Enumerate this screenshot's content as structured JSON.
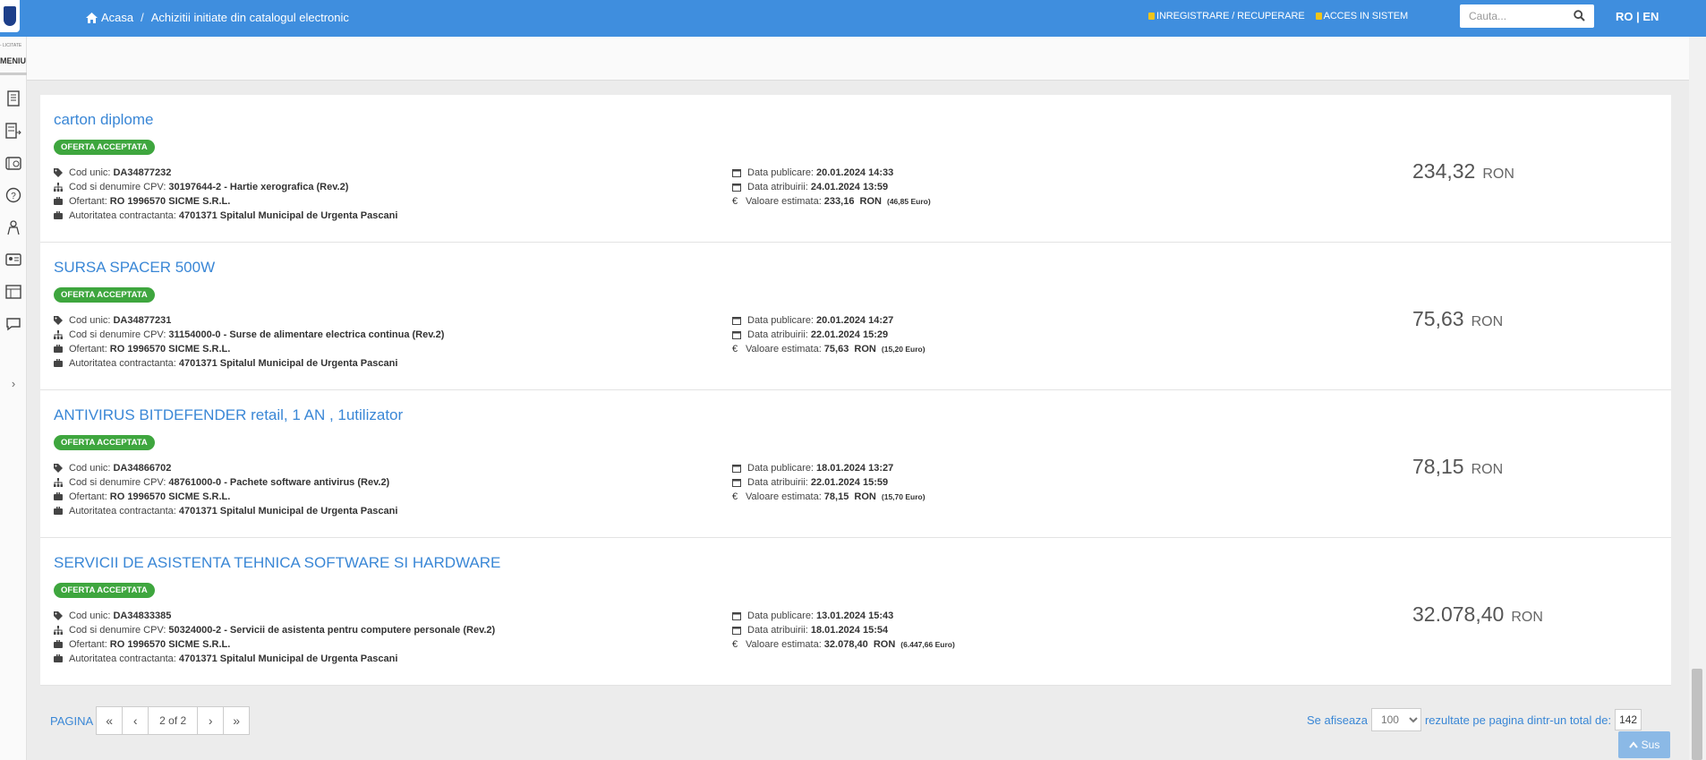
{
  "header": {
    "breadcrumb_home": "Acasa",
    "breadcrumb_separator": "/",
    "breadcrumb_current": "Achizitii initiate din catalogul electronic",
    "register_link": "INREGISTRARE / RECUPERARE",
    "login_link": "ACCES IN SISTEM",
    "search_placeholder": "Cauta...",
    "language": "RO | EN"
  },
  "sidebar": {
    "top_text": "- LICITATE",
    "menu_label": "MENIU",
    "expand_glyph": "›",
    "icons": [
      "document-icon",
      "list-arrow-icon",
      "catalog-icon",
      "help-icon",
      "user-tie-icon",
      "id-card-icon",
      "report-icon",
      "chat-icon"
    ]
  },
  "items": [
    {
      "title": "carton diplome",
      "badge": "OFERTA ACCEPTATA",
      "cod_unic_label": "Cod unic:",
      "cod_unic": "DA34877232",
      "cpv_label": "Cod si denumire CPV:",
      "cpv": "30197644-2 - Hartie xerografica (Rev.2)",
      "ofertant_label": "Ofertant:",
      "ofertant": "RO 1996570 SICME S.R.L.",
      "autoritate_label": "Autoritatea contractanta:",
      "autoritate": "4701371 Spitalul Municipal de Urgenta Pascani",
      "publicare_label": "Data publicare:",
      "publicare": "20.01.2024 14:33",
      "atribuire_label": "Data atribuirii:",
      "atribuire": "24.01.2024 13:59",
      "valoare_label": "Valoare estimata:",
      "valoare": "233,16  RON",
      "euro": "(46,85 Euro)",
      "price": "234,32",
      "currency": "RON"
    },
    {
      "title": "SURSA SPACER 500W",
      "badge": "OFERTA ACCEPTATA",
      "cod_unic_label": "Cod unic:",
      "cod_unic": "DA34877231",
      "cpv_label": "Cod si denumire CPV:",
      "cpv": "31154000-0 - Surse de alimentare electrica continua (Rev.2)",
      "ofertant_label": "Ofertant:",
      "ofertant": "RO 1996570 SICME S.R.L.",
      "autoritate_label": "Autoritatea contractanta:",
      "autoritate": "4701371 Spitalul Municipal de Urgenta Pascani",
      "publicare_label": "Data publicare:",
      "publicare": "20.01.2024 14:27",
      "atribuire_label": "Data atribuirii:",
      "atribuire": "22.01.2024 15:29",
      "valoare_label": "Valoare estimata:",
      "valoare": "75,63  RON",
      "euro": "(15,20 Euro)",
      "price": "75,63",
      "currency": "RON"
    },
    {
      "title": "ANTIVIRUS BITDEFENDER retail, 1 AN , 1utilizator",
      "badge": "OFERTA ACCEPTATA",
      "cod_unic_label": "Cod unic:",
      "cod_unic": "DA34866702",
      "cpv_label": "Cod si denumire CPV:",
      "cpv": "48761000-0 - Pachete software antivirus (Rev.2)",
      "ofertant_label": "Ofertant:",
      "ofertant": "RO 1996570 SICME S.R.L.",
      "autoritate_label": "Autoritatea contractanta:",
      "autoritate": "4701371 Spitalul Municipal de Urgenta Pascani",
      "publicare_label": "Data publicare:",
      "publicare": "18.01.2024 13:27",
      "atribuire_label": "Data atribuirii:",
      "atribuire": "22.01.2024 15:59",
      "valoare_label": "Valoare estimata:",
      "valoare": "78,15  RON",
      "euro": "(15,70 Euro)",
      "price": "78,15",
      "currency": "RON"
    },
    {
      "title": "SERVICII DE ASISTENTA TEHNICA SOFTWARE SI HARDWARE",
      "badge": "OFERTA ACCEPTATA",
      "cod_unic_label": "Cod unic:",
      "cod_unic": "DA34833385",
      "cpv_label": "Cod si denumire CPV:",
      "cpv": "50324000-2 - Servicii de asistenta pentru computere personale (Rev.2)",
      "ofertant_label": "Ofertant:",
      "ofertant": "RO 1996570 SICME S.R.L.",
      "autoritate_label": "Autoritatea contractanta:",
      "autoritate": "4701371 Spitalul Municipal de Urgenta Pascani",
      "publicare_label": "Data publicare:",
      "publicare": "13.01.2024 15:43",
      "atribuire_label": "Data atribuirii:",
      "atribuire": "18.01.2024 15:54",
      "valoare_label": "Valoare estimata:",
      "valoare": "32.078,40  RON",
      "euro": "(6.447,66 Euro)",
      "price": "32.078,40",
      "currency": "RON"
    }
  ],
  "pagination": {
    "label": "PAGINA",
    "first": "«",
    "prev": "‹",
    "info": "2 of 2",
    "next": "›",
    "last": "»",
    "showing_label": "Se afiseaza",
    "per_page": "100",
    "results_label": "rezultate pe pagina dintr-un total de:",
    "total": "142"
  },
  "back_to_top": "Sus",
  "colors": {
    "header_bg": "#3f8ede",
    "link": "#3a87d6",
    "badge_green": "#3ea63e"
  }
}
